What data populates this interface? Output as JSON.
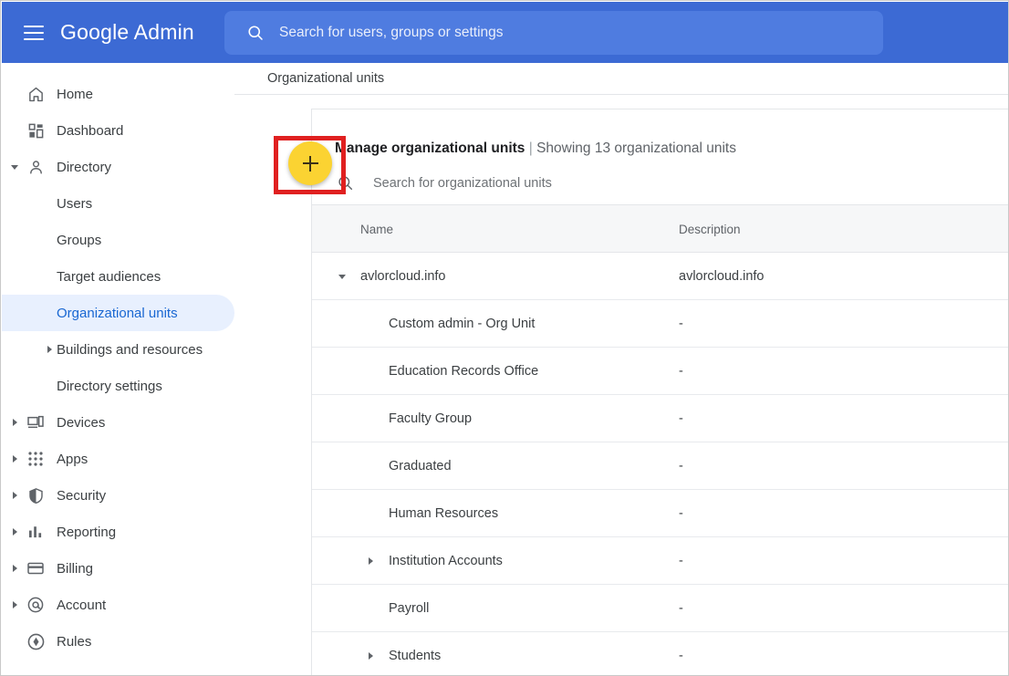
{
  "header": {
    "menu_icon": "hamburger-icon",
    "brand": "Google Admin",
    "search": {
      "icon": "search-icon",
      "placeholder": "Search for users, groups or settings",
      "value": ""
    }
  },
  "sidebar": {
    "items": [
      {
        "label": "Home",
        "icon": "home-icon",
        "level": 0,
        "expander": "none",
        "selected": false
      },
      {
        "label": "Dashboard",
        "icon": "dashboard-icon",
        "level": 0,
        "expander": "none",
        "selected": false
      },
      {
        "label": "Directory",
        "icon": "person-icon",
        "level": 0,
        "expander": "down",
        "selected": false
      },
      {
        "label": "Users",
        "icon": "none",
        "level": 1,
        "expander": "none",
        "selected": false
      },
      {
        "label": "Groups",
        "icon": "none",
        "level": 1,
        "expander": "none",
        "selected": false
      },
      {
        "label": "Target audiences",
        "icon": "none",
        "level": 1,
        "expander": "none",
        "selected": false
      },
      {
        "label": "Organizational units",
        "icon": "none",
        "level": 1,
        "expander": "none",
        "selected": true
      },
      {
        "label": "Buildings and resources",
        "icon": "none",
        "level": 1,
        "expander": "right",
        "selected": false
      },
      {
        "label": "Directory settings",
        "icon": "none",
        "level": 1,
        "expander": "none",
        "selected": false
      },
      {
        "label": "Devices",
        "icon": "devices-icon",
        "level": 0,
        "expander": "right",
        "selected": false
      },
      {
        "label": "Apps",
        "icon": "apps-grid-icon",
        "level": 0,
        "expander": "right",
        "selected": false
      },
      {
        "label": "Security",
        "icon": "shield-icon",
        "level": 0,
        "expander": "right",
        "selected": false
      },
      {
        "label": "Reporting",
        "icon": "bar-chart-icon",
        "level": 0,
        "expander": "right",
        "selected": false
      },
      {
        "label": "Billing",
        "icon": "credit-card-icon",
        "level": 0,
        "expander": "right",
        "selected": false
      },
      {
        "label": "Account",
        "icon": "at-sign-icon",
        "level": 0,
        "expander": "right",
        "selected": false
      },
      {
        "label": "Rules",
        "icon": "rules-icon",
        "level": 0,
        "expander": "none",
        "selected": false
      }
    ]
  },
  "main": {
    "breadcrumb": "Organizational units",
    "card": {
      "title": "Manage organizational units",
      "title_separator": "|",
      "subtitle": "Showing 13 organizational units",
      "add_button": {
        "icon": "plus-icon",
        "label": "",
        "color": "#fbd332"
      },
      "search": {
        "icon": "search-icon",
        "placeholder": "Search for organizational units",
        "value": ""
      },
      "columns": [
        "Name",
        "Description"
      ],
      "rows": [
        {
          "name": "avlorcloud.info",
          "description": "avlorcloud.info",
          "level": 0,
          "expander": "down"
        },
        {
          "name": "Custom admin - Org Unit",
          "description": "-",
          "level": 1,
          "expander": "none"
        },
        {
          "name": "Education Records Office",
          "description": "-",
          "level": 1,
          "expander": "none"
        },
        {
          "name": "Faculty Group",
          "description": "-",
          "level": 1,
          "expander": "none"
        },
        {
          "name": "Graduated",
          "description": "-",
          "level": 1,
          "expander": "none"
        },
        {
          "name": "Human Resources",
          "description": "-",
          "level": 1,
          "expander": "none"
        },
        {
          "name": "Institution Accounts",
          "description": "-",
          "level": 1,
          "expander": "right"
        },
        {
          "name": "Payroll",
          "description": "-",
          "level": 1,
          "expander": "none"
        },
        {
          "name": "Students",
          "description": "-",
          "level": 1,
          "expander": "right"
        }
      ]
    }
  },
  "annotation": {
    "highlight_color": "#e02020",
    "target": "add-organizational-unit-button"
  }
}
